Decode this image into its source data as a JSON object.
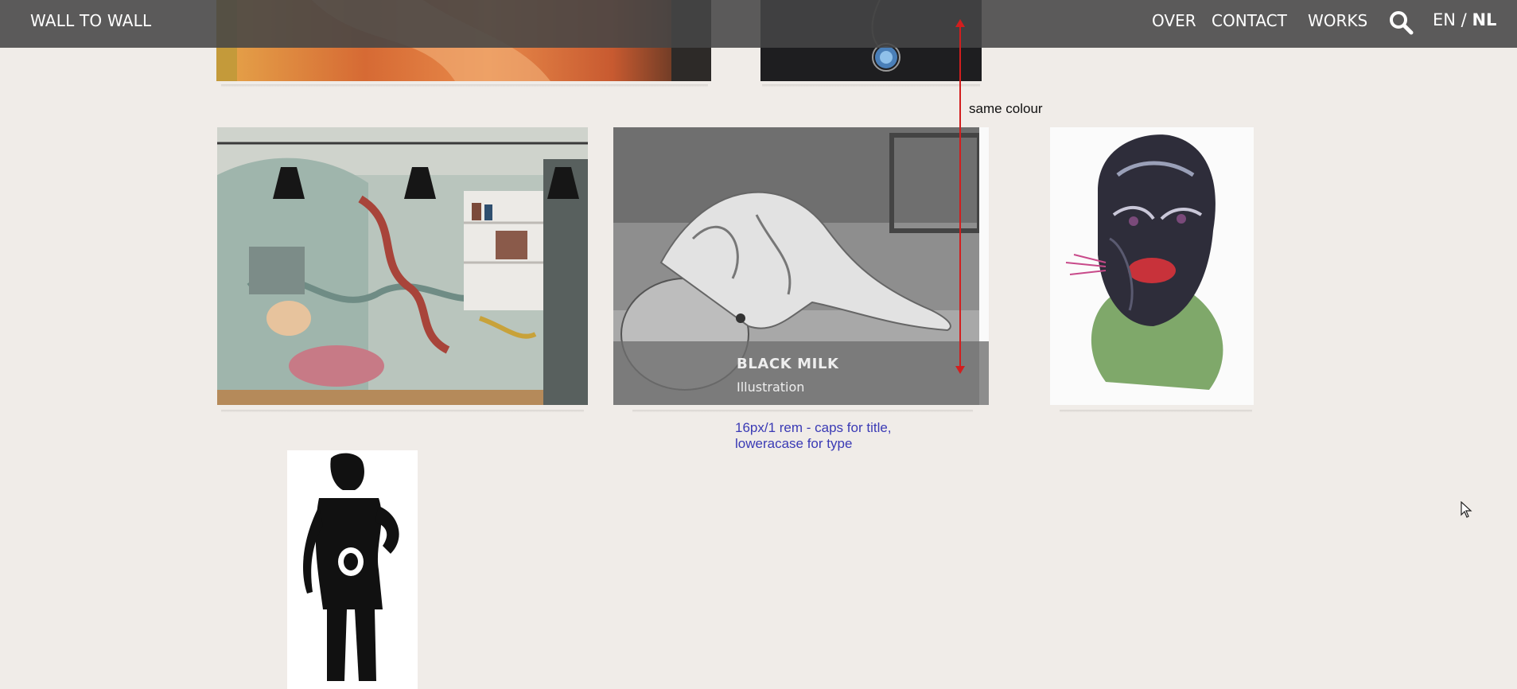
{
  "header": {
    "brand": "WALL TO WALL",
    "nav": [
      "OVER",
      "CONTACT",
      "WORKS"
    ],
    "lang_en": "EN",
    "lang_sep": "/",
    "lang_nl": "NL",
    "active_lang": "NL"
  },
  "works": [
    {
      "image": "orange painting (cropped)"
    },
    {
      "image": "dark artwork with blue ornament (cropped)"
    },
    {
      "image": "mural with dragon and waves in living room"
    },
    {
      "image": "pencil drawing of draped figure",
      "title": "BLACK MILK",
      "type": "Illustration"
    },
    {
      "image": "colored illustration of face"
    },
    {
      "image": "black and white stencil figure"
    }
  ],
  "annotations": {
    "same_colour": "same colour",
    "typography_note_line1": "16px/1 rem - caps for title,",
    "typography_note_line2": "loweracase for type"
  },
  "colors": {
    "background": "#f0ece8",
    "header_bg": "#464646",
    "annotation_red": "#d21e1e",
    "annotation_blue": "#3a3ab5"
  }
}
